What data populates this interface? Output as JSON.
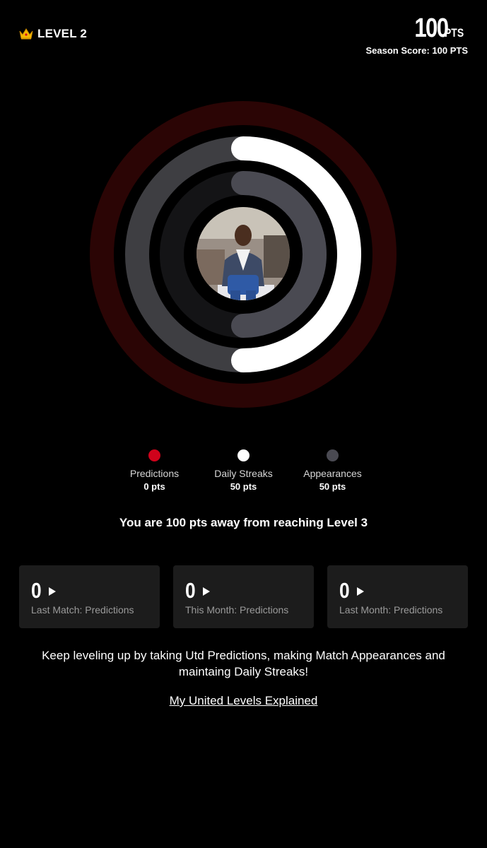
{
  "header": {
    "level_label": "LEVEL 2",
    "points_value": "100",
    "points_unit": "PTS",
    "season_score": "Season Score: 100 PTS"
  },
  "legend": [
    {
      "label": "Predictions",
      "value": "0 pts",
      "color": "#d0021b"
    },
    {
      "label": "Daily Streaks",
      "value": "50 pts",
      "color": "#ffffff"
    },
    {
      "label": "Appearances",
      "value": "50 pts",
      "color": "#4a4a52"
    }
  ],
  "progress": {
    "predictions_fraction": 0.0,
    "daily_streaks_fraction": 0.5,
    "appearances_fraction": 0.5
  },
  "away_message": "You are 100 pts away from reaching Level 3",
  "stats": [
    {
      "value": "0",
      "label": "Last Match: Predictions"
    },
    {
      "value": "0",
      "label": "This Month: Predictions"
    },
    {
      "value": "0",
      "label": "Last Month: Predictions"
    }
  ],
  "keep_message": "Keep leveling up by taking Utd Predictions, making Match Appearances and maintaing Daily Streaks!",
  "explained_link": "My United Levels Explained",
  "icons": {
    "crown": "crown-icon",
    "play": "play-icon"
  }
}
